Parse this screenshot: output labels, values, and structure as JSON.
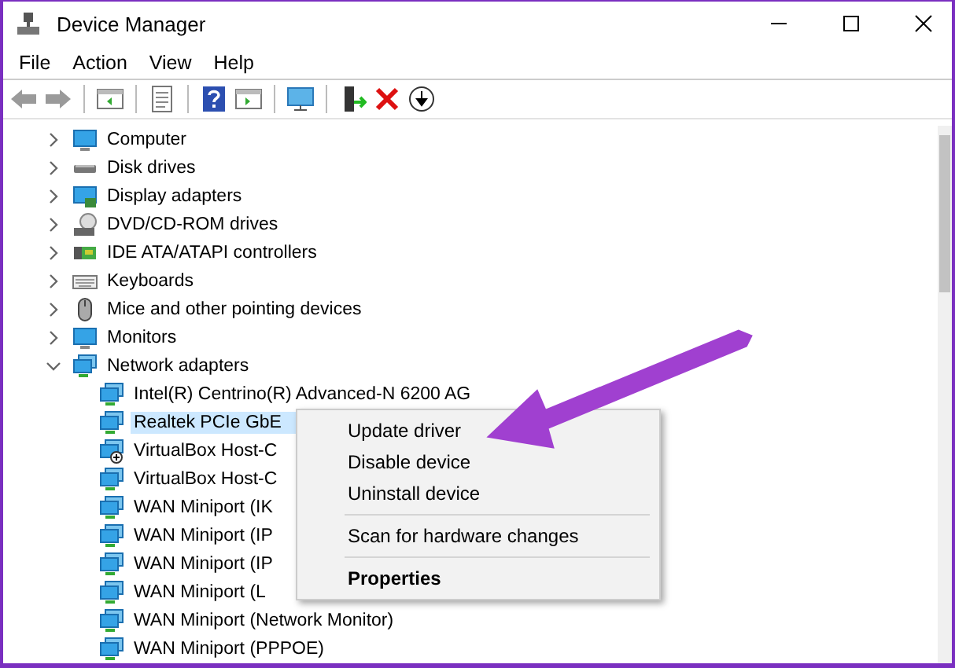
{
  "window": {
    "title": "Device Manager"
  },
  "menu": [
    "File",
    "Action",
    "View",
    "Help"
  ],
  "toolbar": [
    {
      "kind": "back",
      "disabled": true
    },
    {
      "kind": "forward",
      "disabled": true
    },
    {
      "kind": "sep"
    },
    {
      "kind": "tree"
    },
    {
      "kind": "sep"
    },
    {
      "kind": "props"
    },
    {
      "kind": "sep"
    },
    {
      "kind": "help"
    },
    {
      "kind": "pane"
    },
    {
      "kind": "sep"
    },
    {
      "kind": "scan"
    },
    {
      "kind": "sep"
    },
    {
      "kind": "enable"
    },
    {
      "kind": "remove"
    },
    {
      "kind": "update"
    }
  ],
  "tree": [
    {
      "label": "Computer",
      "kind": "monitor",
      "expanded": false
    },
    {
      "label": "Disk drives",
      "kind": "disk",
      "expanded": false
    },
    {
      "label": "Display adapters",
      "kind": "display",
      "expanded": false
    },
    {
      "label": "DVD/CD-ROM drives",
      "kind": "dvd",
      "expanded": false
    },
    {
      "label": "IDE ATA/ATAPI controllers",
      "kind": "card",
      "expanded": false
    },
    {
      "label": "Keyboards",
      "kind": "keyboard",
      "expanded": false
    },
    {
      "label": "Mice and other pointing devices",
      "kind": "mouse",
      "expanded": false
    },
    {
      "label": "Monitors",
      "kind": "monitor",
      "expanded": false
    },
    {
      "label": "Network adapters",
      "kind": "network",
      "expanded": true,
      "children": [
        {
          "label": "Intel(R) Centrino(R) Advanced-N 6200 AG",
          "kind": "network",
          "selected": false
        },
        {
          "label": "Realtek PCIe GbE",
          "kind": "network",
          "selected": true
        },
        {
          "label": "VirtualBox Host-C",
          "kind": "network-plus",
          "selected": false
        },
        {
          "label": "VirtualBox Host-C",
          "kind": "network",
          "selected": false
        },
        {
          "label": "WAN Miniport (IK",
          "kind": "network",
          "selected": false
        },
        {
          "label": "WAN Miniport (IP",
          "kind": "network",
          "selected": false
        },
        {
          "label": "WAN Miniport (IP",
          "kind": "network",
          "selected": false
        },
        {
          "label": "WAN Miniport (L",
          "kind": "network",
          "selected": false
        },
        {
          "label": "WAN Miniport (Network Monitor)",
          "kind": "network",
          "selected": false
        },
        {
          "label": "WAN Miniport (PPPOE)",
          "kind": "network",
          "selected": false
        }
      ]
    }
  ],
  "context_menu": [
    {
      "kind": "item",
      "label": "Update driver",
      "default": false
    },
    {
      "kind": "item",
      "label": "Disable device",
      "default": false
    },
    {
      "kind": "item",
      "label": "Uninstall device",
      "default": false
    },
    {
      "kind": "separator"
    },
    {
      "kind": "item",
      "label": "Scan for hardware changes",
      "default": false
    },
    {
      "kind": "separator"
    },
    {
      "kind": "item",
      "label": "Properties",
      "default": true
    }
  ]
}
